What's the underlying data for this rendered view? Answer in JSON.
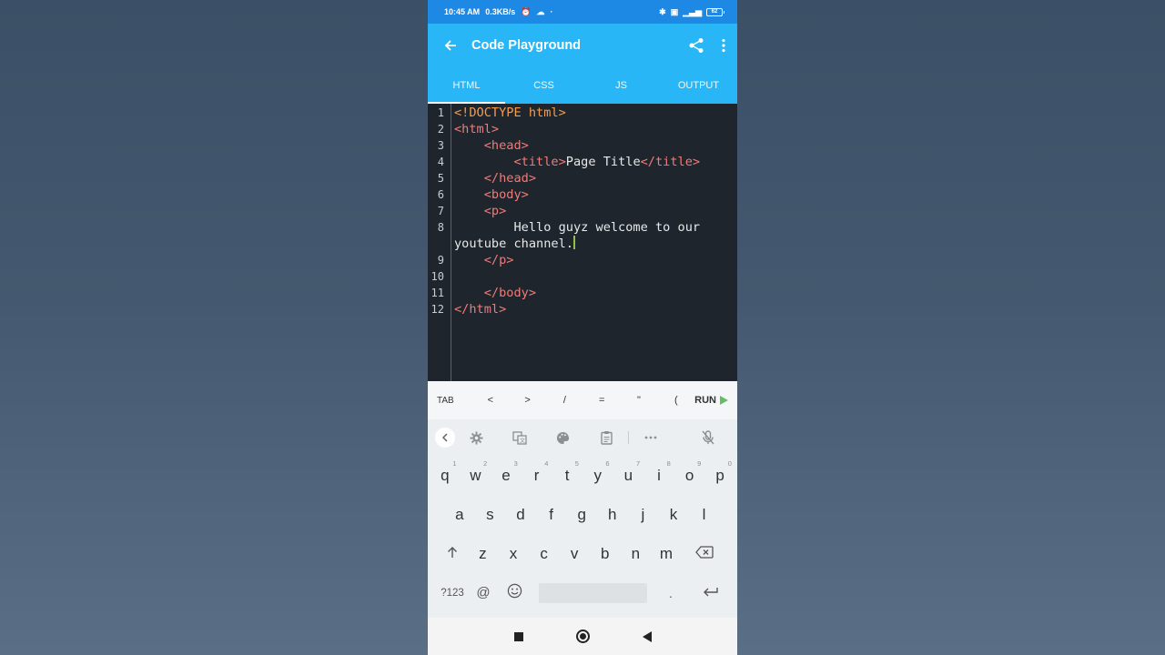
{
  "status_bar": {
    "time": "10:45 AM",
    "speed": "0.3KB/s",
    "battery": "62"
  },
  "app_bar": {
    "title": "Code Playground",
    "back_icon": "arrow-left-icon",
    "share_icon": "share-icon",
    "more_icon": "more-vert-icon"
  },
  "tabs": [
    {
      "label": "HTML",
      "active": true
    },
    {
      "label": "CSS",
      "active": false
    },
    {
      "label": "JS",
      "active": false
    },
    {
      "label": "OUTPUT",
      "active": false
    }
  ],
  "editor": {
    "line_numbers": [
      "1",
      "2",
      "3",
      "4",
      "5",
      "6",
      "7",
      "8",
      "",
      "9",
      "10",
      "11",
      "12"
    ],
    "lines": {
      "l1": "<!DOCTYPE html>",
      "l2": "<html>",
      "l3": "<head>",
      "l4_open": "<title>",
      "l4_text": "Page Title",
      "l4_close": "</title>",
      "l5": "</head>",
      "l6": "<body>",
      "l7": "<p>",
      "l8a": "Hello guyz welcome to our",
      "l8b": "youtube channel.",
      "l9": "</p>",
      "l11": "</body>",
      "l12": "</html>"
    }
  },
  "symbol_bar": {
    "keys": [
      "TAB",
      "<",
      ">",
      "/",
      "=",
      "\"",
      "("
    ],
    "run_label": "RUN"
  },
  "keyboard": {
    "row1": [
      "q",
      "w",
      "e",
      "r",
      "t",
      "y",
      "u",
      "i",
      "o",
      "p"
    ],
    "row1_hints": [
      "1",
      "2",
      "3",
      "4",
      "5",
      "6",
      "7",
      "8",
      "9",
      "0"
    ],
    "row2": [
      "a",
      "s",
      "d",
      "f",
      "g",
      "h",
      "j",
      "k",
      "l"
    ],
    "row3": [
      "z",
      "x",
      "c",
      "v",
      "b",
      "n",
      "m"
    ],
    "mode_key": "?123",
    "at_key": "@",
    "period_key": "."
  }
}
